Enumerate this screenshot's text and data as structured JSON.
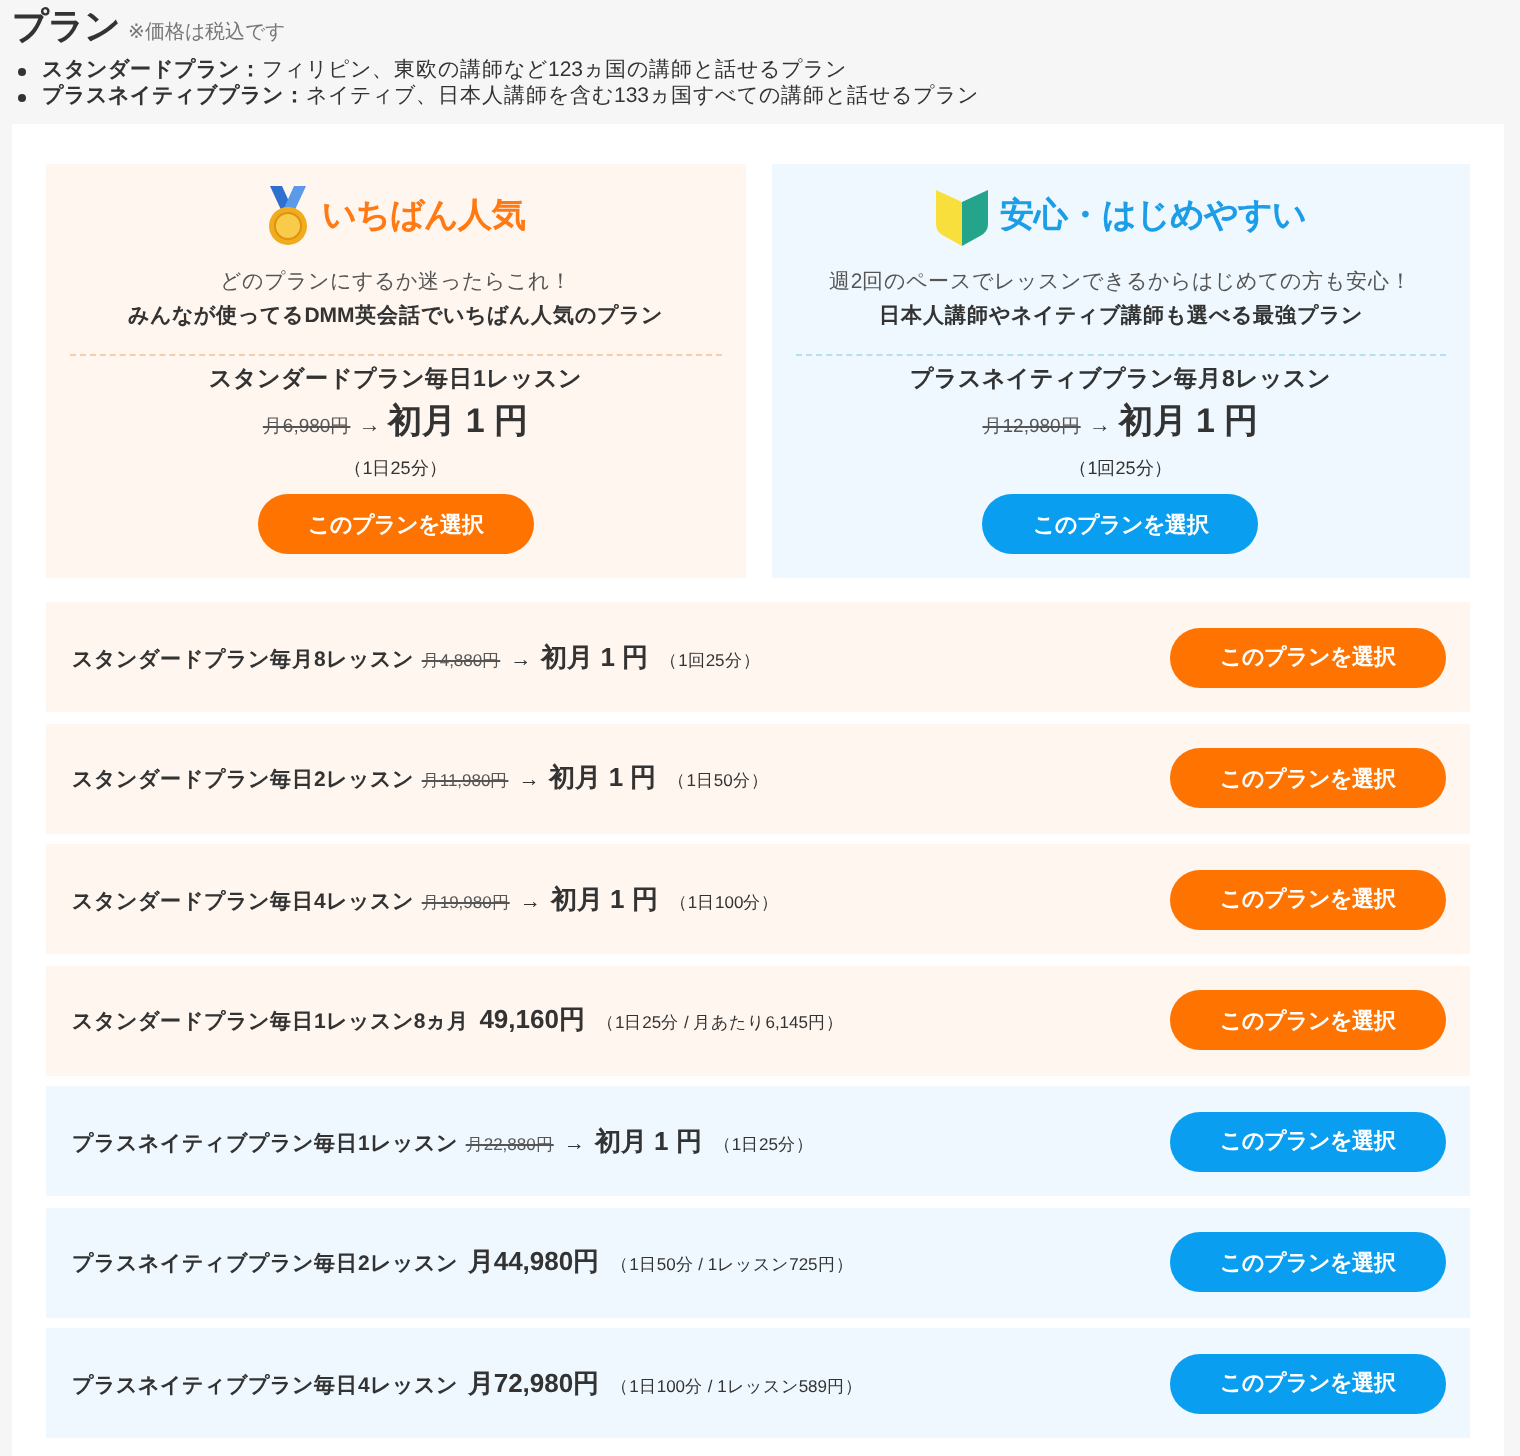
{
  "header": {
    "title": "プラン",
    "note": "※価格は税込です"
  },
  "plan_types": [
    "**スタンダードプラン：**フィリピン、東欧の講師など123ヵ国の講師と話せるプラン",
    "**プラスネイティブプラン：**ネイティブ、日本人講師を含む133ヵ国すべての講師と話せるプラン"
  ],
  "featured_plans": [
    {
      "kind": "standard",
      "badge": "いちばん人気",
      "tagline": "どのプランにするか迷ったらこれ！",
      "highlight": "みんなが使ってるDMM英会話でいちばん人気のプラン",
      "plan": "スタンダードプラン毎日1レッスン",
      "old_price": "月6,980円",
      "arrow": "→",
      "price": "初月 1 円",
      "note": "（1日25分）",
      "button": "このプランを選択"
    },
    {
      "kind": "plus_native",
      "badge": "安心・はじめやすい",
      "tagline": "週2回のペースでレッスンできるからはじめての方も安心！",
      "highlight": "日本人講師やネイティブ講師も選べる最強プラン",
      "plan": "プラスネイティブプラン毎月8レッスン",
      "old_price": "月12,980円",
      "arrow": "→",
      "price": "初月 1 円",
      "note": "（1回25分）",
      "button": "このプランを選択"
    }
  ],
  "plans": [
    {
      "kind": "standard",
      "name": "スタンダードプラン毎月8レッスン",
      "old_price": "月4,880円",
      "arrow": "→",
      "price": "初月 1 円",
      "note": "（1回25分）",
      "button": "このプランを選択"
    },
    {
      "kind": "standard",
      "name": "スタンダードプラン毎日2レッスン",
      "old_price": "月11,980円",
      "arrow": "→",
      "price": "初月 1 円",
      "note": "（1日50分）",
      "button": "このプランを選択"
    },
    {
      "kind": "standard",
      "name": "スタンダードプラン毎日4レッスン",
      "old_price": "月19,980円",
      "arrow": "→",
      "price": "初月 1 円",
      "note": "（1日100分）",
      "button": "このプランを選択"
    },
    {
      "kind": "standard",
      "name": "スタンダードプラン毎日1レッスン8ヵ月",
      "price": "49,160円",
      "note": "（1日25分 / 月あたり6,145円）",
      "button": "このプランを選択"
    },
    {
      "kind": "plus_native",
      "name": "プラスネイティブプラン毎日1レッスン",
      "old_price": "月22,880円",
      "arrow": "→",
      "price": "初月 1 円",
      "note": "（1日25分）",
      "button": "このプランを選択"
    },
    {
      "kind": "plus_native",
      "name": "プラスネイティブプラン毎日2レッスン",
      "price": "月44,980円",
      "note": "（1日50分 / 1レッスン725円）",
      "button": "このプランを選択"
    },
    {
      "kind": "plus_native",
      "name": "プラスネイティブプラン毎日4レッスン",
      "price": "月72,980円",
      "note": "（1日100分 / 1レッスン589円）",
      "button": "このプランを選択"
    }
  ]
}
